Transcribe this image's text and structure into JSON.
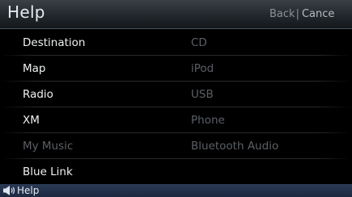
{
  "header": {
    "title": "Help",
    "back_label": "Back",
    "separator": "|",
    "cancel_label": "Cance"
  },
  "menu": {
    "left": [
      {
        "label": "Destination",
        "enabled": true
      },
      {
        "label": "Map",
        "enabled": true
      },
      {
        "label": "Radio",
        "enabled": true
      },
      {
        "label": "XM",
        "enabled": true
      },
      {
        "label": "My Music",
        "enabled": false
      },
      {
        "label": "Blue Link",
        "enabled": true
      }
    ],
    "right": [
      {
        "label": "CD",
        "enabled": false
      },
      {
        "label": "iPod",
        "enabled": false
      },
      {
        "label": "USB",
        "enabled": false
      },
      {
        "label": "Phone",
        "enabled": false
      },
      {
        "label": "Bluetooth Audio",
        "enabled": false
      }
    ]
  },
  "status_bar": {
    "icon": "speaker-icon",
    "label": "Help"
  }
}
